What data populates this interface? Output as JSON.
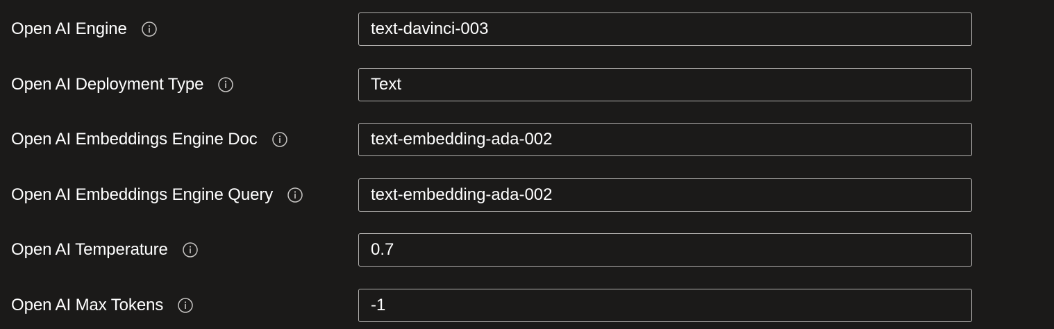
{
  "fields": [
    {
      "label": "Open AI Engine",
      "value": "text-davinci-003"
    },
    {
      "label": "Open AI Deployment Type",
      "value": "Text"
    },
    {
      "label": "Open AI Embeddings Engine Doc",
      "value": "text-embedding-ada-002"
    },
    {
      "label": "Open AI Embeddings Engine Query",
      "value": "text-embedding-ada-002"
    },
    {
      "label": "Open AI Temperature",
      "value": "0.7"
    },
    {
      "label": "Open AI Max Tokens",
      "value": "-1"
    }
  ],
  "icons": {
    "info": "info-circle-icon"
  },
  "colors": {
    "background": "#1b1a19",
    "text": "#ffffff",
    "field_border": "#b5b3b1",
    "icon": "#c8c6c4"
  }
}
